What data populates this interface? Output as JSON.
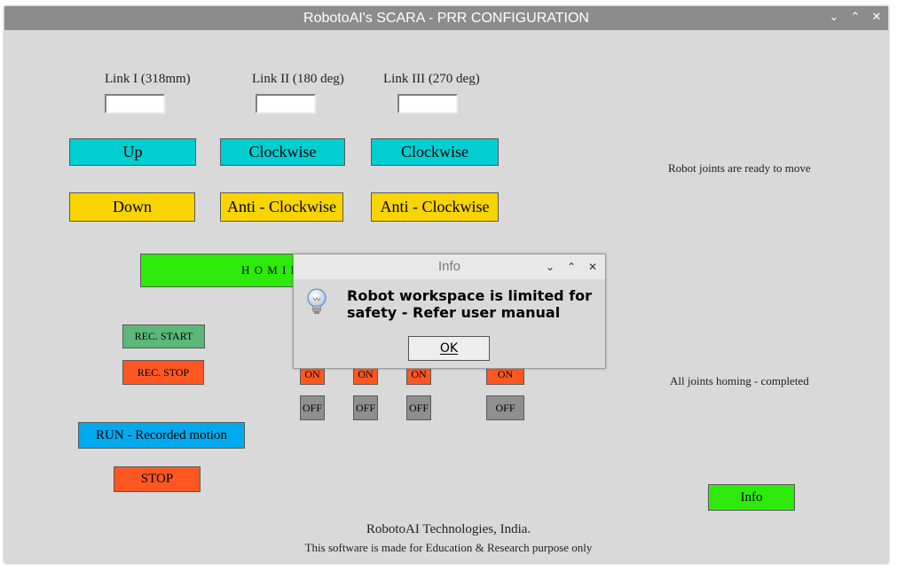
{
  "window": {
    "title": "RobotoAI's SCARA - PRR CONFIGURATION",
    "controls": {
      "minimize": "chevron-down",
      "maximize": "chevron-up",
      "close": "close-x"
    }
  },
  "links": [
    {
      "label": "Link I (318mm)",
      "value": ""
    },
    {
      "label": "Link II (180 deg)",
      "value": ""
    },
    {
      "label": "Link III (270 deg)",
      "value": ""
    }
  ],
  "motion_buttons": {
    "up": "Up",
    "down": "Down",
    "clockwise_2": "Clockwise",
    "clockwise_3": "Clockwise",
    "anticlockwise_2": "Anti - Clockwise",
    "anticlockwise_3": "Anti - Clockwise"
  },
  "homing_button": "H O M I N",
  "record": {
    "start": "REC. START",
    "stop": "REC. STOP"
  },
  "toggles": {
    "on": "ON",
    "off": "OFF"
  },
  "run_button": "RUN - Recorded motion",
  "stop_button": "STOP",
  "status": {
    "joints_ready": "Robot joints are ready to move",
    "homing": "All joints homing - completed"
  },
  "info_button": "Info",
  "footer": {
    "company": "RobotoAI Technologies, India.",
    "note": "This software is made for Education & Research purpose only"
  },
  "dialog": {
    "title": "Info",
    "message": "Robot workspace is limited for safety - Refer user manual",
    "ok": "OK",
    "icon": "lightbulb"
  },
  "colors": {
    "cyan": "#00ced1",
    "yellow": "#f8d400",
    "green": "#2eea0a",
    "orange": "#ff5722",
    "blue": "#00aaee",
    "grey": "#8f8f8f"
  }
}
